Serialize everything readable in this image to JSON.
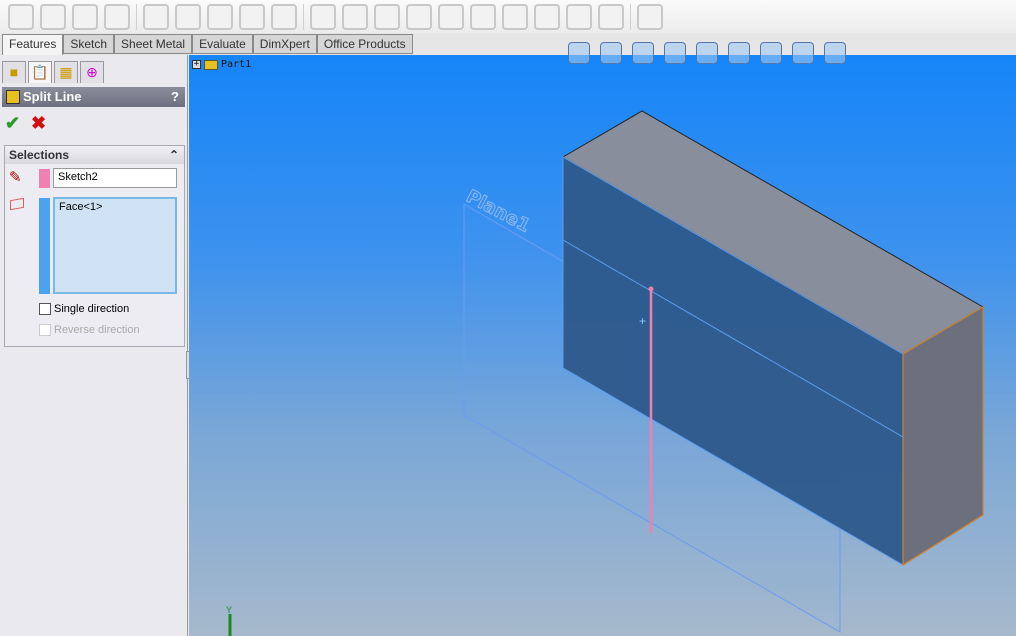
{
  "tabs": [
    "Features",
    "Sketch",
    "Sheet Metal",
    "Evaluate",
    "DimXpert",
    "Office Products"
  ],
  "panel": {
    "title": "Split Line",
    "help": "?",
    "ok_icon": "check-icon",
    "cancel_icon": "x-icon",
    "selections": {
      "header": "Selections",
      "sketch_field": "Sketch2",
      "faces_field": "Face<1>",
      "single_direction": "Single direction",
      "reverse_direction": "Reverse direction",
      "single_checked": false,
      "reverse_enabled": false
    }
  },
  "tree": {
    "expand": "+",
    "root": "Part1"
  },
  "scene": {
    "plane_label": "Plane1",
    "axis_label": "Y"
  },
  "colors": {
    "sketch": "#f080b0",
    "face": "#4aa2f0",
    "viewport_top": "#1585f8",
    "box_face": "#2e5a8a"
  }
}
